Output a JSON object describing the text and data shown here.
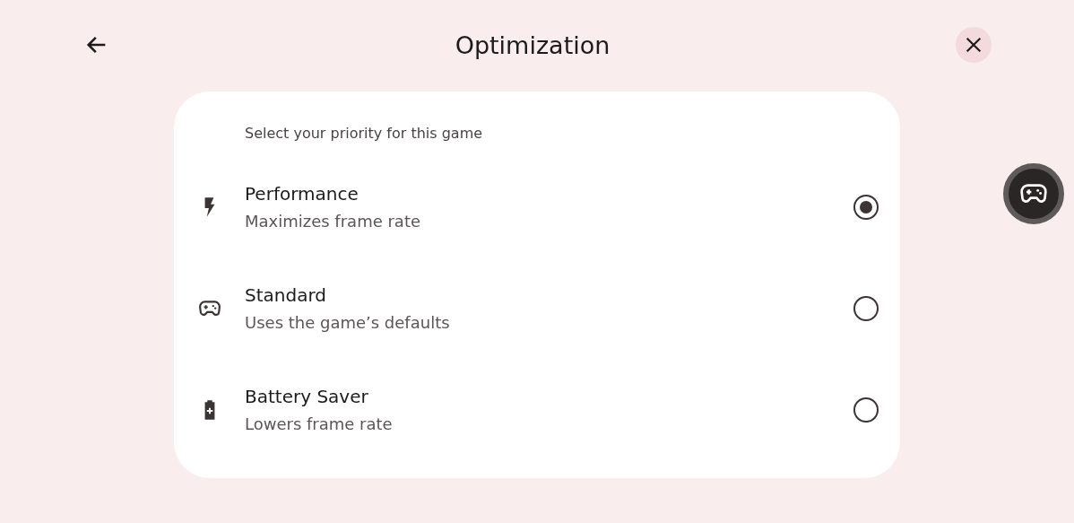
{
  "header": {
    "title": "Optimization"
  },
  "card": {
    "heading": "Select your priority for this game",
    "options": [
      {
        "kind": "bolt",
        "title": "Performance",
        "subtitle": "Maximizes frame rate",
        "selected": true
      },
      {
        "kind": "gamepad",
        "title": "Standard",
        "subtitle": "Uses the game’s defaults",
        "selected": false
      },
      {
        "kind": "battery",
        "title": "Battery Saver",
        "subtitle": "Lowers frame rate",
        "selected": false
      }
    ]
  }
}
